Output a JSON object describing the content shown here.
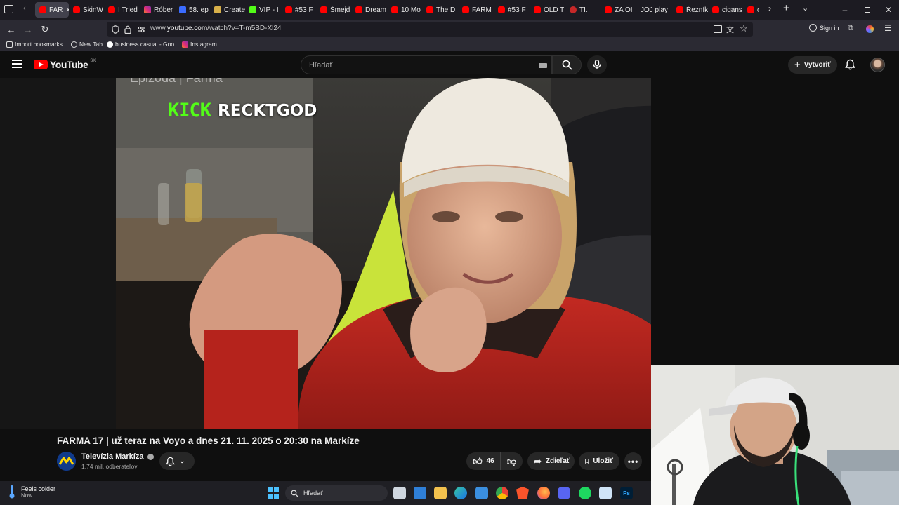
{
  "browser": {
    "tabs": [
      {
        "label": "FAR",
        "icon": "youtube-icon",
        "active": true
      },
      {
        "label": "SkinW",
        "icon": "youtube-icon"
      },
      {
        "label": "I Tried",
        "icon": "youtube-icon"
      },
      {
        "label": "Róber",
        "icon": "instagram-icon"
      },
      {
        "label": "58. ep",
        "icon": "v-icon"
      },
      {
        "label": "Create",
        "icon": "doc-icon"
      },
      {
        "label": "VIP - I",
        "icon": "kick-icon"
      },
      {
        "label": "#53 F",
        "icon": "youtube-icon"
      },
      {
        "label": "Šmejd",
        "icon": "youtube-icon"
      },
      {
        "label": "Dream",
        "icon": "youtube-icon"
      },
      {
        "label": "10 Mo",
        "icon": "youtube-icon"
      },
      {
        "label": "The D",
        "icon": "youtube-icon"
      },
      {
        "label": "FARM",
        "icon": "youtube-icon"
      },
      {
        "label": "#53 F",
        "icon": "youtube-icon"
      },
      {
        "label": "OLD T",
        "icon": "youtube-icon"
      },
      {
        "label": "TI.",
        "icon": "record-icon"
      },
      {
        "label": "ZA OI",
        "icon": "youtube-icon"
      },
      {
        "label": "JOJ play",
        "icon": "none"
      },
      {
        "label": "Řezník",
        "icon": "youtube-icon"
      },
      {
        "label": "cigans",
        "icon": "youtube-icon"
      },
      {
        "label": "co",
        "icon": "youtube-icon"
      }
    ],
    "url_prefix": "www.",
    "url_host": "youtube.com",
    "url_path": "/watch?v=T-m5BD-Xl24",
    "sign_in": "Sign in",
    "bookmarks": [
      {
        "label": "Import bookmarks..."
      },
      {
        "label": "New Tab"
      },
      {
        "label": "business casual - Goo..."
      },
      {
        "label": "Instagram"
      }
    ]
  },
  "youtube": {
    "logo": "YouTube",
    "region": "SK",
    "search_placeholder": "Hľadať",
    "create_label": "Vytvoriť",
    "video_overlay_top": "Epizóda  |  Farma",
    "kick_logo": "KICK",
    "kick_user": "RECKTGOD",
    "title": "FARMA 17 | už teraz na Voyo a dnes 21. 11. 2025 o 20:30 na Markíze",
    "channel_name": "Televízia Markíza",
    "subscribers": "1,74 mil. odberateľov",
    "likes": "46",
    "share_label": "Zdieľať",
    "save_label": "Uložiť"
  },
  "taskbar": {
    "weather_title": "Feels colder",
    "weather_sub": "Now",
    "search_label": "Hľadať"
  }
}
